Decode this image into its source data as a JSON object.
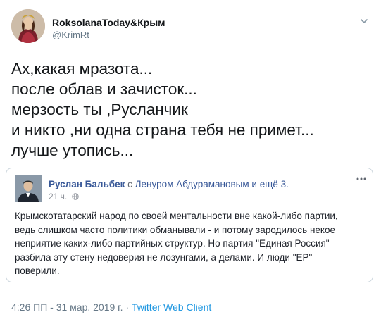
{
  "user": {
    "display_name": "RoksolanaToday&Крым",
    "handle": "@KrimRt",
    "avatar_icon": "portrait-avatar",
    "more_icon": "chevron-down-icon"
  },
  "tweet": {
    "lines": [
      "Ах,какая мразота...",
      "после облав и зачисток...",
      "мерзость ты ,Русланчик",
      "и никто ,ни одна страна тебя не примет...",
      "лучше утопись..."
    ]
  },
  "quoted_post": {
    "author": "Руслан Бальбек",
    "with_word": "с",
    "tagged": "Ленуром Абдурамановым и ещё 3.",
    "date": "21 ч.",
    "privacy_icon": "globe-icon",
    "more_icon": "more-dots-icon",
    "body_lines": [
      "Крымскотатарский народ по своей ментальности вне какой-либо партии,",
      "ведь слишком часто политики обманывали - и потому зародилось некое",
      "неприятие каких-либо партийных структур. Но партия \"Единая Россия\"",
      "разбила эту стену недоверия не лозунгами, а делами. И люди \"ЕР\"",
      "поверили."
    ]
  },
  "meta": {
    "time": "4:26 ПП - 31 мар. 2019 г.",
    "separator": " · ",
    "source": "Twitter Web Client"
  },
  "colors": {
    "text": "#14171a",
    "secondary": "#657786",
    "link": "#1b95e0",
    "fb_link": "#385898",
    "border": "#ccd6dd"
  }
}
